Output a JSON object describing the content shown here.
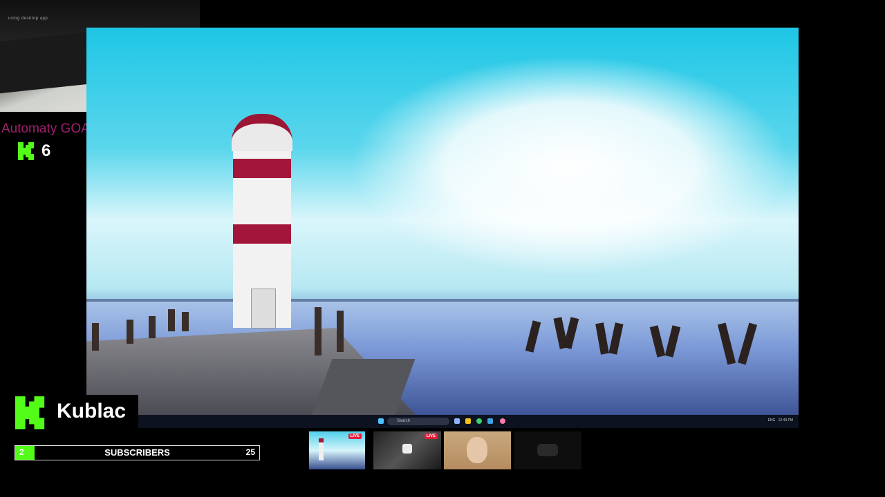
{
  "webcam": {
    "caption": "using desktop app"
  },
  "donor": {
    "text": "Automaty GOAT top donator",
    "count": "6"
  },
  "desktop": {
    "search_placeholder": "Search",
    "tray": {
      "lang": "ENG",
      "time": "12:43 PM"
    }
  },
  "channel": {
    "name": "Kublac"
  },
  "subscribers": {
    "label": "SUBSCRIBERS",
    "current": "2",
    "goal": "25",
    "progress_fraction": 0.08
  },
  "thumbnails": [
    {
      "live_label": "LIVE"
    },
    {
      "live_label": "LIVE"
    },
    {},
    {}
  ],
  "colors": {
    "kick_green": "#53fc18",
    "donor_text": "#a0206e",
    "live_red": "#e91c3a",
    "lighthouse_red": "#a3163b"
  }
}
